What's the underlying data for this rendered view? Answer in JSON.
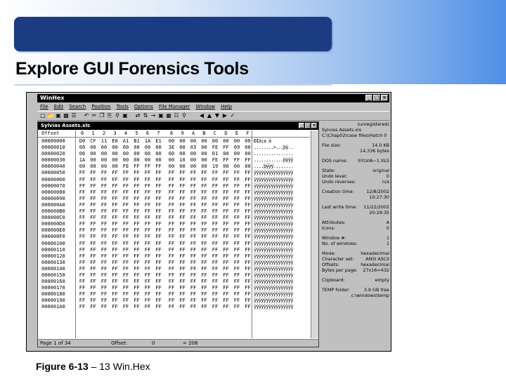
{
  "slide": {
    "title": "Explore GUI Forensics Tools",
    "caption_figure": "Figure 6-13",
    "caption_text": "– 13 Win.Hex"
  },
  "app": {
    "title": "WinHex",
    "menu": [
      "File",
      "Edit",
      "Search",
      "Position",
      "Tools",
      "Options",
      "File Manager",
      "Window",
      "Help"
    ],
    "window_buttons": [
      "_",
      "□",
      "×"
    ],
    "toolbar_icons": [
      "new-icon",
      "open-icon",
      "save-icon",
      "print-icon",
      "properties-icon",
      "undo-icon",
      "cut-icon",
      "copy-icon",
      "paste-icon",
      "find-icon",
      "find-hex-icon",
      "replace-icon",
      "replace-hex-icon",
      "goto-icon",
      "disk-icon",
      "ram-icon",
      "calculator-icon",
      "search-icon",
      "back-icon",
      "up-icon",
      "down-icon",
      "right-icon",
      "check-icon"
    ]
  },
  "hex": {
    "window_title": "Sylvias Assets.xls",
    "header_offset_label": "Offset",
    "columns": [
      "0",
      "1",
      "2",
      "3",
      "4",
      "5",
      "6",
      "7",
      "8",
      "9",
      "A",
      "B",
      "C",
      "D",
      "E",
      "F"
    ],
    "rows": [
      {
        "offset": "00000000",
        "bytes": [
          "D0",
          "CF",
          "11",
          "E0",
          "A1",
          "B1",
          "1A",
          "E1",
          "00",
          "00",
          "00",
          "00",
          "00",
          "00",
          "00",
          "00"
        ],
        "ascii": "ÐÏà¡± á"
      },
      {
        "offset": "00000010",
        "bytes": [
          "00",
          "00",
          "00",
          "00",
          "00",
          "00",
          "00",
          "00",
          "3E",
          "00",
          "03",
          "00",
          "FE",
          "FF",
          "09",
          "00"
        ],
        "ascii": "........>...þÿ.."
      },
      {
        "offset": "00000020",
        "bytes": [
          "06",
          "00",
          "00",
          "00",
          "00",
          "00",
          "00",
          "00",
          "00",
          "00",
          "00",
          "00",
          "01",
          "00",
          "00",
          "00"
        ],
        "ascii": "................"
      },
      {
        "offset": "00000030",
        "bytes": [
          "1A",
          "00",
          "00",
          "00",
          "00",
          "00",
          "00",
          "00",
          "00",
          "10",
          "00",
          "00",
          "FE",
          "FF",
          "FF",
          "FF"
        ],
        "ascii": "............þÿÿÿ"
      },
      {
        "offset": "00000040",
        "bytes": [
          "00",
          "00",
          "00",
          "00",
          "FE",
          "FF",
          "FF",
          "FF",
          "00",
          "00",
          "00",
          "00",
          "19",
          "00",
          "00",
          "00"
        ],
        "ascii": "....þÿÿÿ........"
      },
      {
        "offset": "00000050",
        "bytes": [
          "FF",
          "FF",
          "FF",
          "FF",
          "FF",
          "FF",
          "FF",
          "FF",
          "FF",
          "FF",
          "FF",
          "FF",
          "FF",
          "FF",
          "FF",
          "FF"
        ],
        "ascii": "ÿÿÿÿÿÿÿÿÿÿÿÿÿÿÿÿ"
      },
      {
        "offset": "00000060",
        "bytes": [
          "FF",
          "FF",
          "FF",
          "FF",
          "FF",
          "FF",
          "FF",
          "FF",
          "FF",
          "FF",
          "FF",
          "FF",
          "FF",
          "FF",
          "FF",
          "FF"
        ],
        "ascii": "ÿÿÿÿÿÿÿÿÿÿÿÿÿÿÿÿ"
      },
      {
        "offset": "00000070",
        "bytes": [
          "FF",
          "FF",
          "FF",
          "FF",
          "FF",
          "FF",
          "FF",
          "FF",
          "FF",
          "FF",
          "FF",
          "FF",
          "FF",
          "FF",
          "FF",
          "FF"
        ],
        "ascii": "ÿÿÿÿÿÿÿÿÿÿÿÿÿÿÿÿ"
      },
      {
        "offset": "00000080",
        "bytes": [
          "FF",
          "FF",
          "FF",
          "FF",
          "FF",
          "FF",
          "FF",
          "FF",
          "FF",
          "FF",
          "FF",
          "FF",
          "FF",
          "FF",
          "FF",
          "FF"
        ],
        "ascii": "ÿÿÿÿÿÿÿÿÿÿÿÿÿÿÿÿ"
      },
      {
        "offset": "00000090",
        "bytes": [
          "FF",
          "FF",
          "FF",
          "FF",
          "FF",
          "FF",
          "FF",
          "FF",
          "FF",
          "FF",
          "FF",
          "FF",
          "FF",
          "FF",
          "FF",
          "FF"
        ],
        "ascii": "ÿÿÿÿÿÿÿÿÿÿÿÿÿÿÿÿ"
      },
      {
        "offset": "000000A0",
        "bytes": [
          "FF",
          "FF",
          "FF",
          "FF",
          "FF",
          "FF",
          "FF",
          "FF",
          "FF",
          "FF",
          "FF",
          "FF",
          "FF",
          "FF",
          "FF",
          "FF"
        ],
        "ascii": "ÿÿÿÿÿÿÿÿÿÿÿÿÿÿÿÿ"
      },
      {
        "offset": "000000B0",
        "bytes": [
          "FF",
          "FF",
          "FF",
          "FF",
          "FF",
          "FF",
          "FF",
          "FF",
          "FF",
          "FF",
          "FF",
          "FF",
          "FF",
          "FF",
          "FF",
          "FF"
        ],
        "ascii": "ÿÿÿÿÿÿÿÿÿÿÿÿÿÿÿÿ"
      },
      {
        "offset": "000000C0",
        "bytes": [
          "FF",
          "FF",
          "FF",
          "FF",
          "FF",
          "FF",
          "FF",
          "FF",
          "FF",
          "FF",
          "FF",
          "FF",
          "FF",
          "FF",
          "FF",
          "FF"
        ],
        "ascii": "ÿÿÿÿÿÿÿÿÿÿÿÿÿÿÿÿ"
      },
      {
        "offset": "000000D0",
        "bytes": [
          "FF",
          "FF",
          "FF",
          "FF",
          "FF",
          "FF",
          "FF",
          "FF",
          "FF",
          "FF",
          "FF",
          "FF",
          "FF",
          "FF",
          "FF",
          "FF"
        ],
        "ascii": "ÿÿÿÿÿÿÿÿÿÿÿÿÿÿÿÿ"
      },
      {
        "offset": "000000E0",
        "bytes": [
          "FF",
          "FF",
          "FF",
          "FF",
          "FF",
          "FF",
          "FF",
          "FF",
          "FF",
          "FF",
          "FF",
          "FF",
          "FF",
          "FF",
          "FF",
          "FF"
        ],
        "ascii": "ÿÿÿÿÿÿÿÿÿÿÿÿÿÿÿÿ"
      },
      {
        "offset": "000000F0",
        "bytes": [
          "FF",
          "FF",
          "FF",
          "FF",
          "FF",
          "FF",
          "FF",
          "FF",
          "FF",
          "FF",
          "FF",
          "FF",
          "FF",
          "FF",
          "FF",
          "FF"
        ],
        "ascii": "ÿÿÿÿÿÿÿÿÿÿÿÿÿÿÿÿ"
      },
      {
        "offset": "00000100",
        "bytes": [
          "FF",
          "FF",
          "FF",
          "FF",
          "FF",
          "FF",
          "FF",
          "FF",
          "FF",
          "FF",
          "FF",
          "FF",
          "FF",
          "FF",
          "FF",
          "FF"
        ],
        "ascii": "ÿÿÿÿÿÿÿÿÿÿÿÿÿÿÿÿ"
      },
      {
        "offset": "00000110",
        "bytes": [
          "FF",
          "FF",
          "FF",
          "FF",
          "FF",
          "FF",
          "FF",
          "FF",
          "FF",
          "FF",
          "FF",
          "FF",
          "FF",
          "FF",
          "FF",
          "FF"
        ],
        "ascii": "ÿÿÿÿÿÿÿÿÿÿÿÿÿÿÿÿ"
      },
      {
        "offset": "00000120",
        "bytes": [
          "FF",
          "FF",
          "FF",
          "FF",
          "FF",
          "FF",
          "FF",
          "FF",
          "FF",
          "FF",
          "FF",
          "FF",
          "FF",
          "FF",
          "FF",
          "FF"
        ],
        "ascii": "ÿÿÿÿÿÿÿÿÿÿÿÿÿÿÿÿ"
      },
      {
        "offset": "00000130",
        "bytes": [
          "FF",
          "FF",
          "FF",
          "FF",
          "FF",
          "FF",
          "FF",
          "FF",
          "FF",
          "FF",
          "FF",
          "FF",
          "FF",
          "FF",
          "FF",
          "FF"
        ],
        "ascii": "ÿÿÿÿÿÿÿÿÿÿÿÿÿÿÿÿ"
      },
      {
        "offset": "00000140",
        "bytes": [
          "FF",
          "FF",
          "FF",
          "FF",
          "FF",
          "FF",
          "FF",
          "FF",
          "FF",
          "FF",
          "FF",
          "FF",
          "FF",
          "FF",
          "FF",
          "FF"
        ],
        "ascii": "ÿÿÿÿÿÿÿÿÿÿÿÿÿÿÿÿ"
      },
      {
        "offset": "00000150",
        "bytes": [
          "FF",
          "FF",
          "FF",
          "FF",
          "FF",
          "FF",
          "FF",
          "FF",
          "FF",
          "FF",
          "FF",
          "FF",
          "FF",
          "FF",
          "FF",
          "FF"
        ],
        "ascii": "ÿÿÿÿÿÿÿÿÿÿÿÿÿÿÿÿ"
      },
      {
        "offset": "00000160",
        "bytes": [
          "FF",
          "FF",
          "FF",
          "FF",
          "FF",
          "FF",
          "FF",
          "FF",
          "FF",
          "FF",
          "FF",
          "FF",
          "FF",
          "FF",
          "FF",
          "FF"
        ],
        "ascii": "ÿÿÿÿÿÿÿÿÿÿÿÿÿÿÿÿ"
      },
      {
        "offset": "00000170",
        "bytes": [
          "FF",
          "FF",
          "FF",
          "FF",
          "FF",
          "FF",
          "FF",
          "FF",
          "FF",
          "FF",
          "FF",
          "FF",
          "FF",
          "FF",
          "FF",
          "FF"
        ],
        "ascii": "ÿÿÿÿÿÿÿÿÿÿÿÿÿÿÿÿ"
      },
      {
        "offset": "00000180",
        "bytes": [
          "FF",
          "FF",
          "FF",
          "FF",
          "FF",
          "FF",
          "FF",
          "FF",
          "FF",
          "FF",
          "FF",
          "FF",
          "FF",
          "FF",
          "FF",
          "FF"
        ],
        "ascii": "ÿÿÿÿÿÿÿÿÿÿÿÿÿÿÿÿ"
      },
      {
        "offset": "00000190",
        "bytes": [
          "FF",
          "FF",
          "FF",
          "FF",
          "FF",
          "FF",
          "FF",
          "FF",
          "FF",
          "FF",
          "FF",
          "FF",
          "FF",
          "FF",
          "FF",
          "FF"
        ],
        "ascii": "ÿÿÿÿÿÿÿÿÿÿÿÿÿÿÿÿ"
      },
      {
        "offset": "000001A0",
        "bytes": [
          "FF",
          "FF",
          "FF",
          "FF",
          "FF",
          "FF",
          "FF",
          "FF",
          "FF",
          "FF",
          "FF",
          "FF",
          "FF",
          "FF",
          "FF",
          "FF"
        ],
        "ascii": "ÿÿÿÿÿÿÿÿÿÿÿÿÿÿÿÿ"
      }
    ],
    "status": {
      "page": "Page 1 of 34",
      "offset_label": "Offset:",
      "offset_value": "0",
      "value": "= 208"
    }
  },
  "info_panel": [
    {
      "k": "",
      "v": "(unregistered)"
    },
    {
      "k": "Sylvias Assets.xls",
      "v": ""
    },
    {
      "k": "C:\\Chap02\\case files\\Hatch 0",
      "v": ""
    },
    {
      "gap": true
    },
    {
      "k": "File size:",
      "v": "14.0 KB"
    },
    {
      "k": "",
      "v": "14,336 bytes"
    },
    {
      "gap": true
    },
    {
      "k": "DOS name:",
      "v": "SYLVIA~1.XLS"
    },
    {
      "gap": true
    },
    {
      "k": "State:",
      "v": "original"
    },
    {
      "k": "Undo level:",
      "v": "0"
    },
    {
      "k": "Undo reverses:",
      "v": "n/a"
    },
    {
      "gap": true
    },
    {
      "k": "Creation time:",
      "v": "12/8/2002"
    },
    {
      "k": "",
      "v": "10:27:30"
    },
    {
      "gap": true
    },
    {
      "k": "Last write time:",
      "v": "11/22/2002"
    },
    {
      "k": "",
      "v": "20:29:35"
    },
    {
      "gap": true
    },
    {
      "k": "Attributes:",
      "v": "A"
    },
    {
      "k": "Icons:",
      "v": "0"
    },
    {
      "gap": true
    },
    {
      "k": "Window #:",
      "v": "1"
    },
    {
      "k": "No. of windows:",
      "v": "1"
    },
    {
      "gap": true
    },
    {
      "k": "Mode:",
      "v": "hexadecimal"
    },
    {
      "k": "Character set:",
      "v": "ANSI ASCII"
    },
    {
      "k": "Offsets:",
      "v": "hexadecimal"
    },
    {
      "k": "Bytes per page:",
      "v": "27x16=432"
    },
    {
      "gap": true
    },
    {
      "k": "Clipboard:",
      "v": "empty"
    },
    {
      "gap": true
    },
    {
      "k": "TEMP folder:",
      "v": "3.9 GB free"
    },
    {
      "k": "",
      "v": "c:\\windows\\temp"
    }
  ]
}
